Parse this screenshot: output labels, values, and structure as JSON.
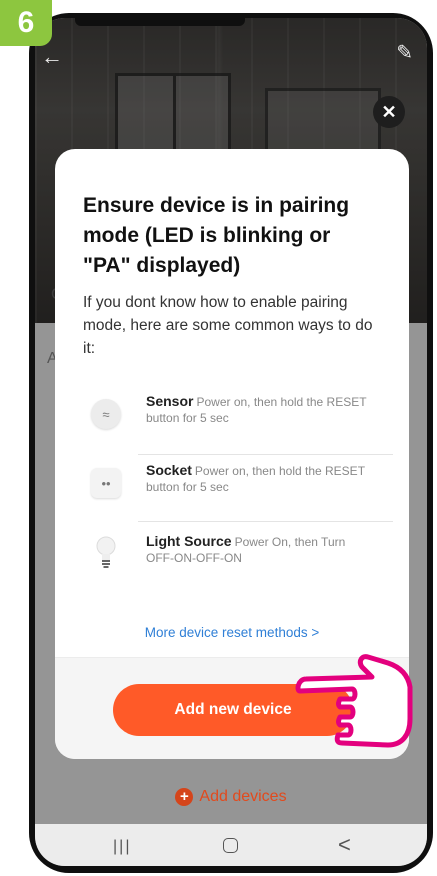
{
  "step_number": "6",
  "header": {
    "back_icon": "back-arrow-icon",
    "edit_icon": "pencil-icon"
  },
  "background": {
    "side_label_c": "C",
    "side_label_a": "A"
  },
  "dialog": {
    "close_icon": "close-icon",
    "title": "Ensure device is in pairing mode (LED is blinking or \"PA\" displayed)",
    "description": "If you dont know how to enable pairing mode, here are some common ways to do it:",
    "methods": [
      {
        "name": "Sensor",
        "instructions": "Power on, then hold the RESET button for 5 sec",
        "icon": "sensor-icon"
      },
      {
        "name": "Socket",
        "instructions": "Power on, then hold the RESET button for 5 sec",
        "icon": "socket-icon"
      },
      {
        "name": "Light Source",
        "instructions": "Power On, then Turn OFF-ON-OFF-ON",
        "icon": "light-bulb-icon"
      }
    ],
    "more_link": "More device reset methods >",
    "add_button": "Add new device"
  },
  "add_devices_label": "Add devices",
  "navbar": {
    "recent": "|||",
    "back": "<"
  },
  "colors": {
    "accent": "#ff5a28",
    "link": "#2f7fd6",
    "badge": "#8dc63f",
    "pointer": "#e3007e"
  }
}
